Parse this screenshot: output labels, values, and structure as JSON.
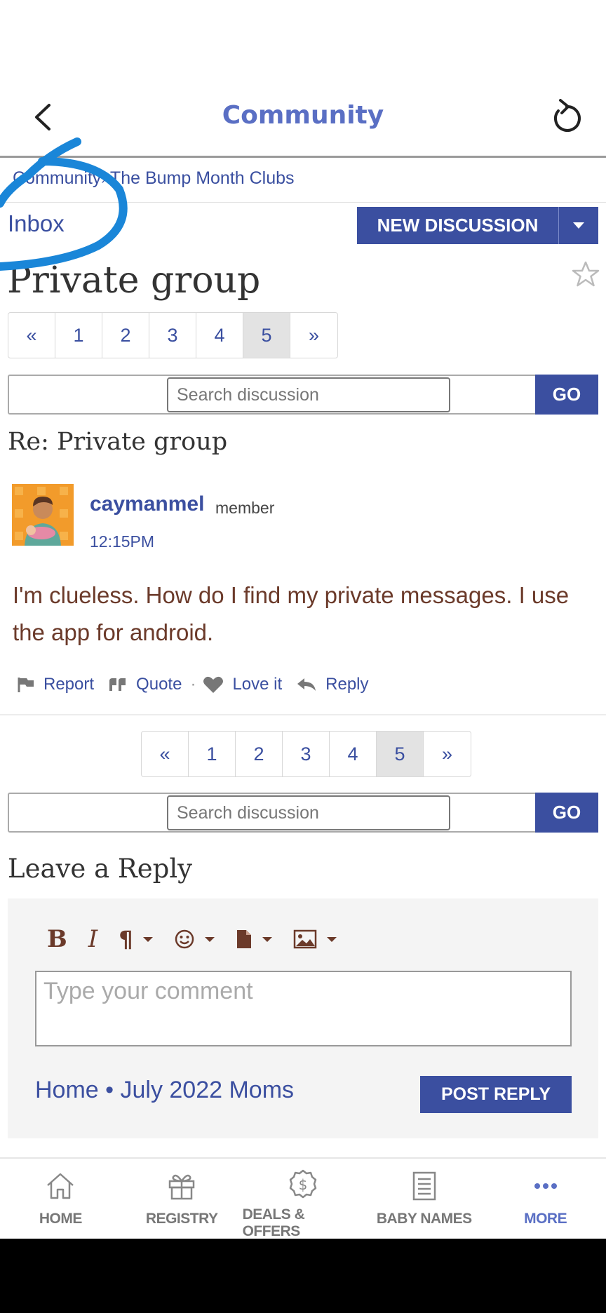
{
  "header": {
    "title": "Community"
  },
  "breadcrumb": {
    "root": "Community",
    "separator": "›",
    "current": "The Bump Month Clubs"
  },
  "inbox_label": "Inbox",
  "new_discussion": {
    "label": "NEW DISCUSSION"
  },
  "thread_title": "Private group",
  "pagination": {
    "prev": "«",
    "pages": [
      "1",
      "2",
      "3",
      "4",
      "5"
    ],
    "next": "»",
    "active_page": "5"
  },
  "search": {
    "placeholder": "Search discussion",
    "go_label": "GO"
  },
  "post": {
    "subject": "Re: Private group",
    "author": "caymanmel",
    "role": "member",
    "time": "12:15PM",
    "body": "I'm clueless.   How do I find my private messages.  I use the app for android.",
    "actions": {
      "report": "Report",
      "quote": "Quote",
      "dot": "·",
      "love": "Love it",
      "reply": "Reply"
    }
  },
  "reply": {
    "title": "Leave a Reply",
    "placeholder": "Type your comment",
    "footer_links": "Home • July 2022 Moms",
    "post_label": "POST REPLY"
  },
  "bottom_nav": {
    "home": "HOME",
    "registry": "REGISTRY",
    "deals": "DEALS & OFFERS",
    "baby_names": "BABY NAMES",
    "more": "MORE"
  },
  "colors": {
    "brand": "#3b4fa0",
    "header_title": "#5a6fc4",
    "annotation": "#1a86d8"
  }
}
